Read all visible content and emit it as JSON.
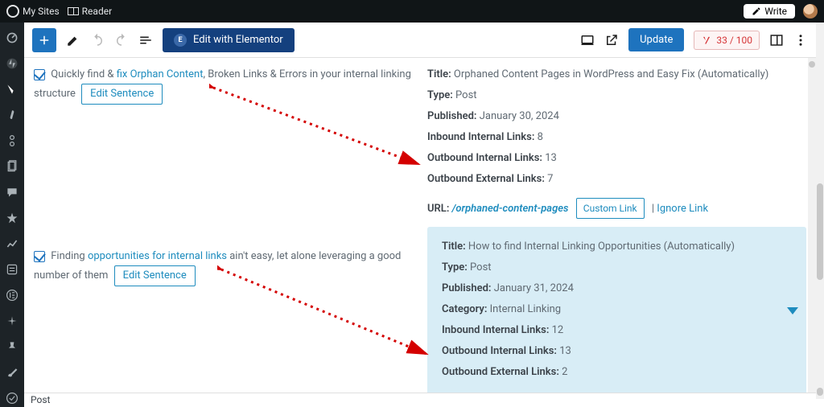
{
  "masterbar": {
    "my_sites": "My Sites",
    "reader": "Reader",
    "write": "Write"
  },
  "editor_header": {
    "elementor_label": "Edit with Elementor",
    "update_label": "Update",
    "yoast_score": "33 / 100"
  },
  "sentences": [
    {
      "pre": "Quickly find & ",
      "anchor": "fix Orphan Content",
      "post": ", Broken Links & Errors in your internal linking structure",
      "edit_label": "Edit Sentence"
    },
    {
      "pre": "Finding ",
      "anchor": "opportunities for internal links",
      "post": " ain't easy, let alone leveraging a good number of them",
      "edit_label": "Edit Sentence"
    }
  ],
  "suggestions": [
    {
      "title_label": "Title:",
      "title": "Orphaned Content Pages in WordPress and Easy Fix (Automatically)",
      "type_label": "Type:",
      "type": "Post",
      "published_label": "Published:",
      "published": "January 30, 2024",
      "inbound_label": "Inbound Internal Links:",
      "inbound": "8",
      "out_internal_label": "Outbound Internal Links:",
      "out_internal": "13",
      "out_external_label": "Outbound External Links:",
      "out_external": "7",
      "url_label": "URL:",
      "url": "/orphaned-content-pages",
      "custom_link": "Custom Link",
      "ignore": "Ignore Link"
    },
    {
      "title_label": "Title:",
      "title": "How to find Internal Linking Opportunities (Automatically)",
      "type_label": "Type:",
      "type": "Post",
      "published_label": "Published:",
      "published": "January 31, 2024",
      "category_label": "Category:",
      "category": "Internal Linking",
      "inbound_label": "Inbound Internal Links:",
      "inbound": "12",
      "out_internal_label": "Outbound Internal Links:",
      "out_internal": "13",
      "out_external_label": "Outbound External Links:",
      "out_external": "2"
    }
  ],
  "footer": {
    "breadcrumb": "Post"
  }
}
